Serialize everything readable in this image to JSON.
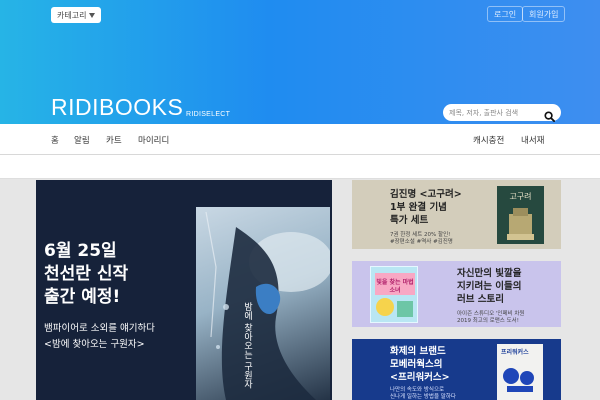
{
  "header": {
    "category_label": "카테고리",
    "login_label": "로그인",
    "signup_label": "회원가입",
    "logo": "RIDIBOOKS",
    "logo_sub": "RIDISELECT",
    "search_placeholder": "제목, 저자, 출판사 검색"
  },
  "nav": {
    "left": [
      "홈",
      "알림",
      "카트",
      "마이리디"
    ],
    "right": [
      "캐시충전",
      "내서재"
    ]
  },
  "main_banner": {
    "title": "6월 25일\n천선란 신작\n출간 예정!",
    "subtitle": "뱀파이어로 소외를 얘기하다\n<밤에 찾아오는 구원자>",
    "cover_text": "밤에 찾아오는 구원자"
  },
  "side_cards": [
    {
      "title": "김진명 <고구려>\n1부 완결 기념\n특가 세트",
      "note": "7권 한정 세트 20% 할인!\n#장편소설 #역사 #김진명",
      "cover_text": "고구려"
    },
    {
      "title": "자신만의 빛깔을\n지키려는 이들의\n러브 스토리",
      "note": "아이즌 스튜디오 '인페비 차원\n2019 최고의 로맨스 도서!",
      "cover_text": "빛을 찾는 마법 소녀"
    },
    {
      "title": "화제의 브랜드\n모베러웍스의\n<프리워커스>",
      "note": "나만의 속도와 방식으로\n신나게 일하는 방법을 말하다",
      "cover_text": "프리워커스"
    }
  ],
  "colors": {
    "accent": "#1f8cf0",
    "banner_bg": "#16223a",
    "card1_bg": "#d3cdbb",
    "card2_bg": "#c9c4ec",
    "card3_bg": "#173a8c"
  }
}
